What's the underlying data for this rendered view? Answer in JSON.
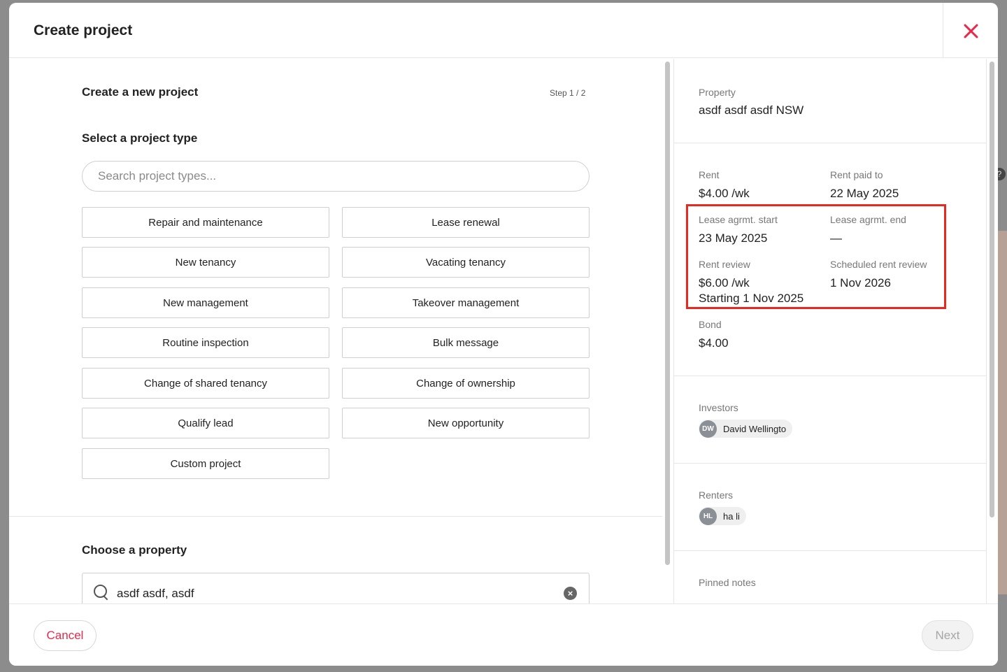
{
  "modal": {
    "title": "Create project"
  },
  "left": {
    "heading": "Create a new project",
    "step": "Step 1 / 2",
    "type_heading": "Select a project type",
    "search_placeholder": "Search project types...",
    "project_types": [
      "Repair and maintenance",
      "Lease renewal",
      "New tenancy",
      "Vacating tenancy",
      "New management",
      "Takeover management",
      "Routine inspection",
      "Bulk message",
      "Change of shared tenancy",
      "Change of ownership",
      "Qualify lead",
      "New opportunity",
      "Custom project"
    ],
    "property_heading": "Choose a property",
    "property_search_value": "asdf asdf, asdf"
  },
  "right": {
    "property_label": "Property",
    "property_value": "asdf asdf asdf NSW",
    "rent_label": "Rent",
    "rent_value": "$4.00 /wk",
    "rent_paid_label": "Rent paid to",
    "rent_paid_value": "22 May 2025",
    "lease_start_label": "Lease agrmt. start",
    "lease_start_value": "23 May 2025",
    "lease_end_label": "Lease agrmt. end",
    "lease_end_value": "—",
    "rent_review_label": "Rent review",
    "rent_review_value": "$6.00 /wk",
    "rent_review_start": "Starting 1 Nov 2025",
    "scheduled_review_label": "Scheduled rent review",
    "scheduled_review_value": "1 Nov 2026",
    "bond_label": "Bond",
    "bond_value": "$4.00",
    "investors_label": "Investors",
    "investor": {
      "initials": "DW",
      "name": "David Wellingto"
    },
    "renters_label": "Renters",
    "renter": {
      "initials": "HL",
      "name": "ha li"
    },
    "pinned_notes_label": "Pinned notes",
    "highlight_color": "#e8291f"
  },
  "footer": {
    "cancel_label": "Cancel",
    "next_label": "Next"
  },
  "colors": {
    "accent": "#e8294a"
  }
}
